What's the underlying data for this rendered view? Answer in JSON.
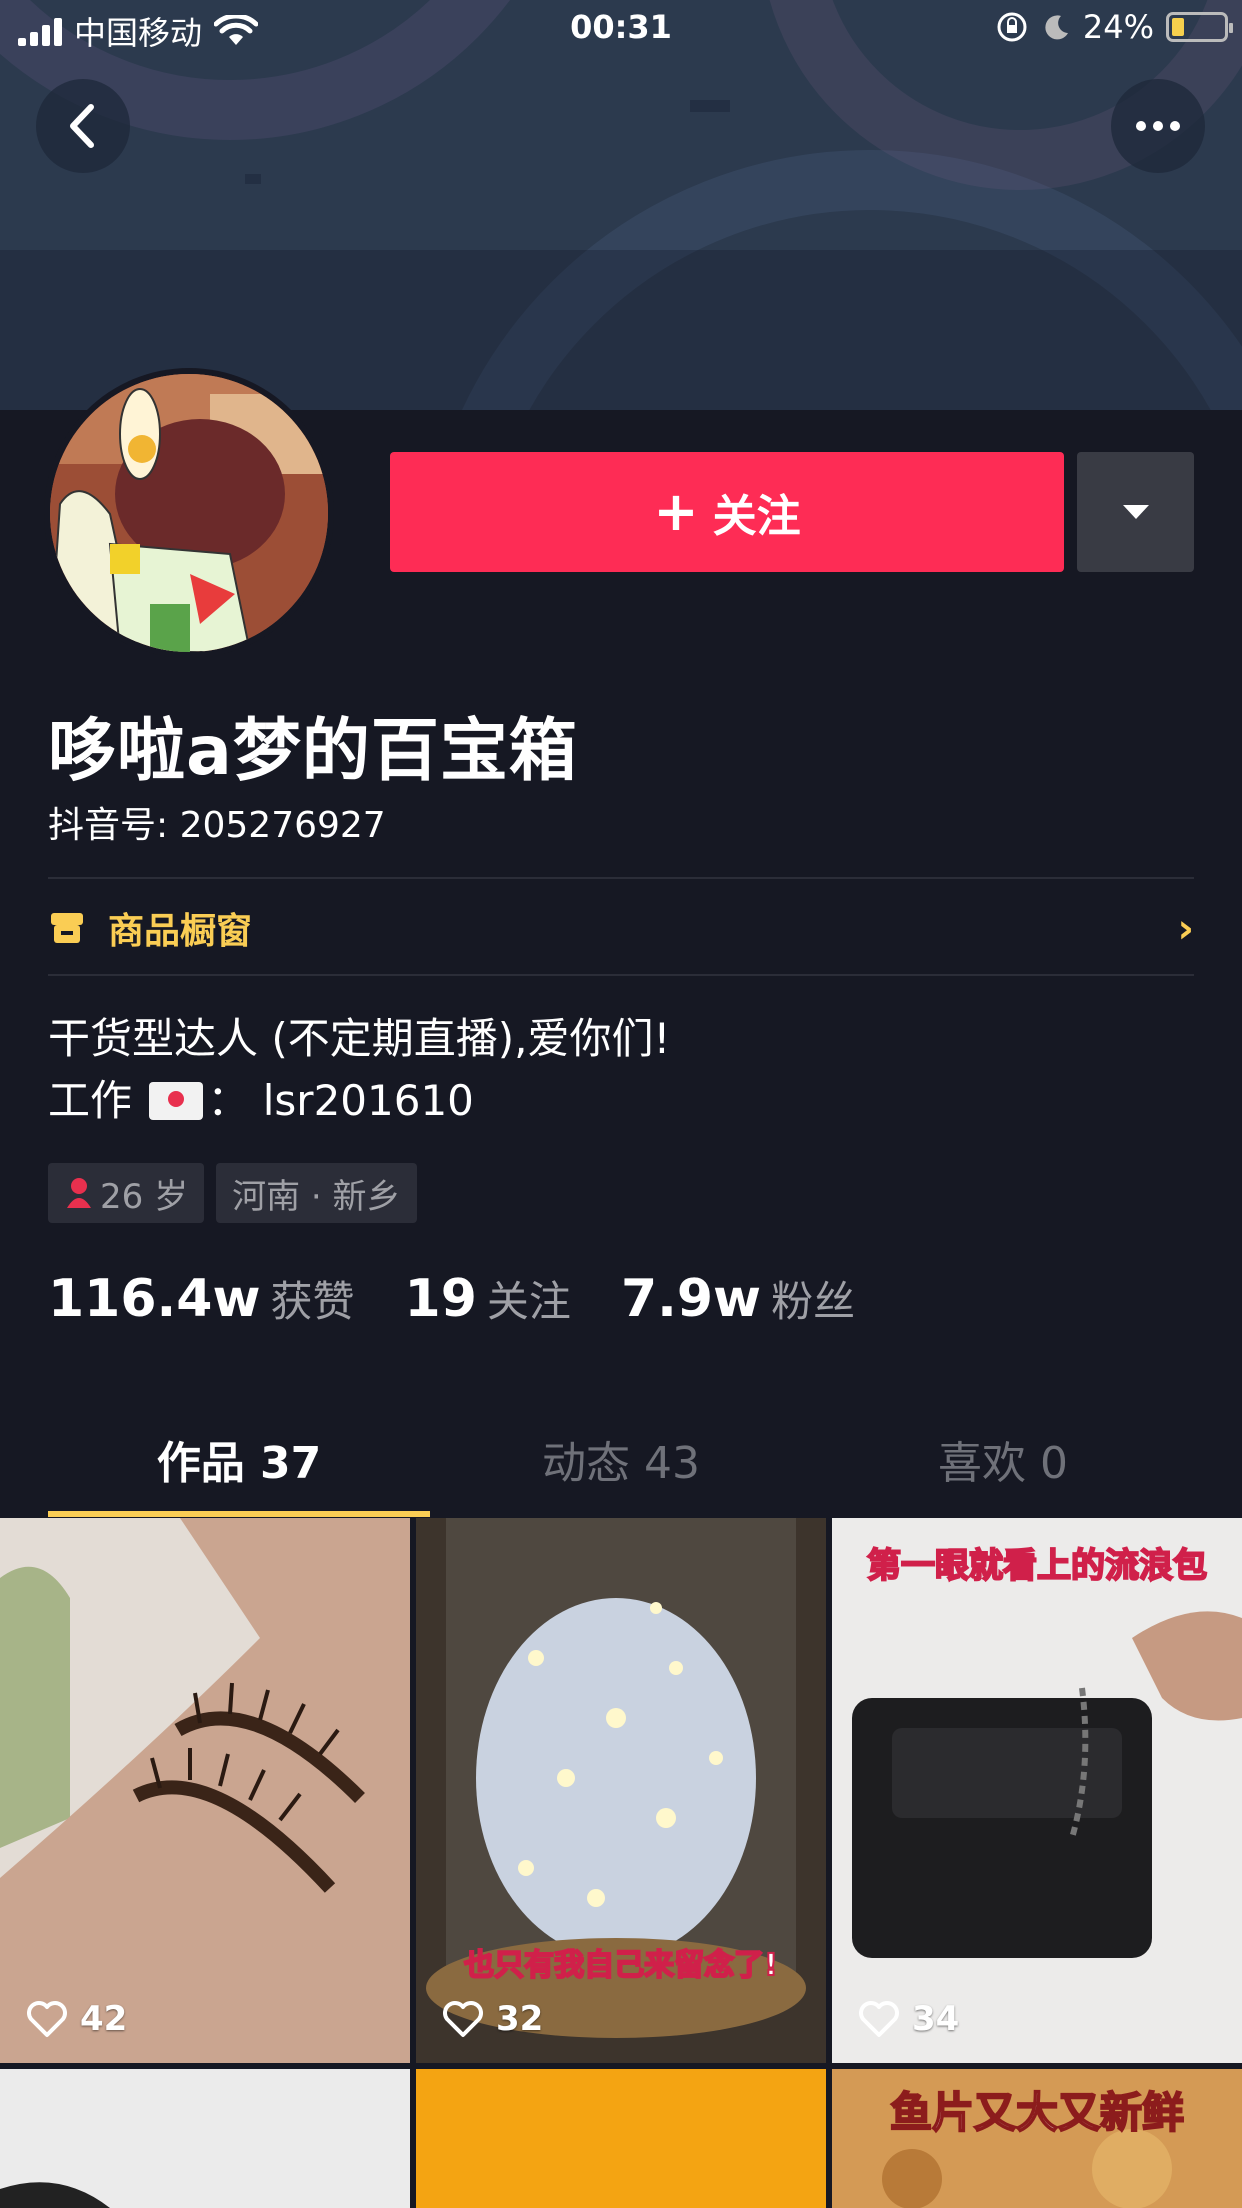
{
  "status_bar": {
    "carrier": "中国移动",
    "time": "00:31",
    "battery": "24%"
  },
  "header": {
    "back_icon": "chevron-left-icon",
    "more_icon": "ellipsis-icon"
  },
  "profile": {
    "follow_label": "关注",
    "name": "哆啦a梦的百宝箱",
    "douyin_id": "抖音号: 205276927",
    "shop_label": "商品橱窗",
    "bio_line1": "干货型达人 (不定期直播),爱你们!",
    "bio_line2_prefix": "工作",
    "bio_line2_value": "lsr201610",
    "age": "26 岁",
    "location": "河南 · 新乡"
  },
  "stats": [
    {
      "num": "116.4w",
      "label": "获赞"
    },
    {
      "num": "19",
      "label": "关注"
    },
    {
      "num": "7.9w",
      "label": "粉丝"
    }
  ],
  "tabs": [
    {
      "label": "作品 37",
      "active": true
    },
    {
      "label": "动态 43",
      "active": false
    },
    {
      "label": "喜欢 0",
      "active": false
    }
  ],
  "videos": [
    {
      "likes": "42",
      "caption": ""
    },
    {
      "likes": "32",
      "caption": "也只有我自己来留念了!"
    },
    {
      "likes": "34",
      "caption": "第一眼就看上的流浪包"
    },
    {
      "likes": "",
      "caption": ""
    },
    {
      "likes": "",
      "caption": ""
    },
    {
      "likes": "",
      "caption": "鱼片又大又新鲜"
    }
  ],
  "colors": {
    "background": "#161823",
    "follow": "#fe2c55",
    "accent": "#facd54"
  }
}
